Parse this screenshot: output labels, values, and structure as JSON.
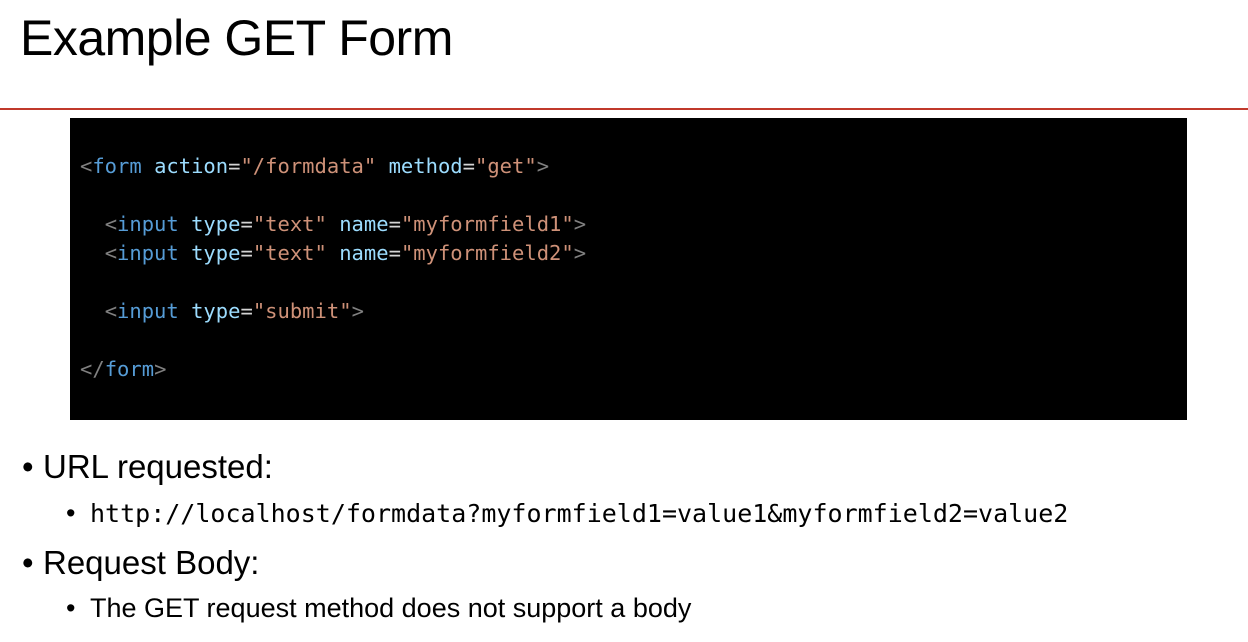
{
  "slide": {
    "title": "Example GET Form"
  },
  "code": {
    "line1": {
      "open": "<",
      "tag": "form",
      "sp1": " ",
      "attr1": "action",
      "eq1": "=",
      "val1": "\"/formdata\"",
      "sp2": " ",
      "attr2": "method",
      "eq2": "=",
      "val2": "\"get\"",
      "close": ">"
    },
    "line2": {
      "indent": "  ",
      "open": "<",
      "tag": "input",
      "sp1": " ",
      "attr1": "type",
      "eq1": "=",
      "val1": "\"text\"",
      "sp2": " ",
      "attr2": "name",
      "eq2": "=",
      "val2": "\"myformfield1\"",
      "close": ">"
    },
    "line3": {
      "indent": "  ",
      "open": "<",
      "tag": "input",
      "sp1": " ",
      "attr1": "type",
      "eq1": "=",
      "val1": "\"text\"",
      "sp2": " ",
      "attr2": "name",
      "eq2": "=",
      "val2": "\"myformfield2\"",
      "close": ">"
    },
    "line4": {
      "indent": "  ",
      "open": "<",
      "tag": "input",
      "sp1": " ",
      "attr1": "type",
      "eq1": "=",
      "val1": "\"submit\"",
      "close": ">"
    },
    "line5": {
      "open": "</",
      "tag": "form",
      "close": ">"
    }
  },
  "bullets": {
    "dot": "•",
    "url_heading": "URL requested:",
    "url_value": "http://localhost/formdata?myformfield1=value1&myformfield2=value2",
    "body_heading": "Request Body:",
    "body_value": "The GET request method does not support a body"
  },
  "colors": {
    "title_rule": "#c0392b",
    "code_background": "#000000",
    "tag": "#569cd6",
    "attribute": "#9cdcfe",
    "string": "#ce9178",
    "bracket": "#808080"
  }
}
